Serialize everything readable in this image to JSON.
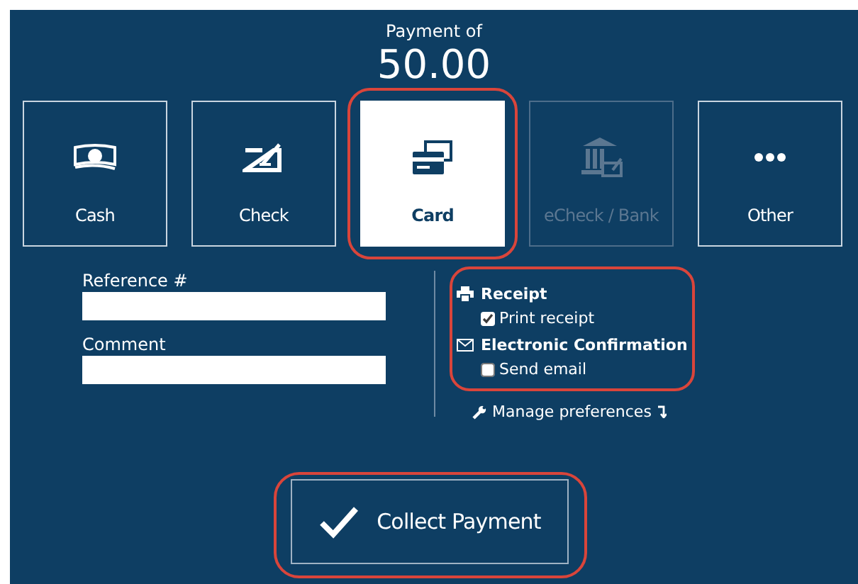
{
  "header": {
    "label": "Payment of",
    "amount": "50.00"
  },
  "methods": [
    {
      "kind": "cash",
      "label": "Cash",
      "selected": false,
      "disabled": false,
      "highlighted": false
    },
    {
      "kind": "check",
      "label": "Check",
      "selected": false,
      "disabled": false,
      "highlighted": false
    },
    {
      "kind": "card",
      "label": "Card",
      "selected": true,
      "disabled": false,
      "highlighted": true
    },
    {
      "kind": "bank",
      "label": "eCheck / Bank",
      "selected": false,
      "disabled": true,
      "highlighted": false
    },
    {
      "kind": "more",
      "label": "Other",
      "selected": false,
      "disabled": false,
      "highlighted": false
    }
  ],
  "fields": [
    {
      "label": "Reference #"
    },
    {
      "label": "Comment"
    }
  ],
  "notifications": {
    "highlighted": true,
    "sections": [
      {
        "kind": "printer",
        "title": "Receipt",
        "option": "Print receipt",
        "checked": true
      },
      {
        "kind": "mail",
        "title": "Electronic Confirmation",
        "option": "Send email",
        "checked": false
      }
    ]
  },
  "manage_link": "Manage preferences",
  "collect_button": {
    "label": "Collect Payment",
    "highlighted": true
  }
}
